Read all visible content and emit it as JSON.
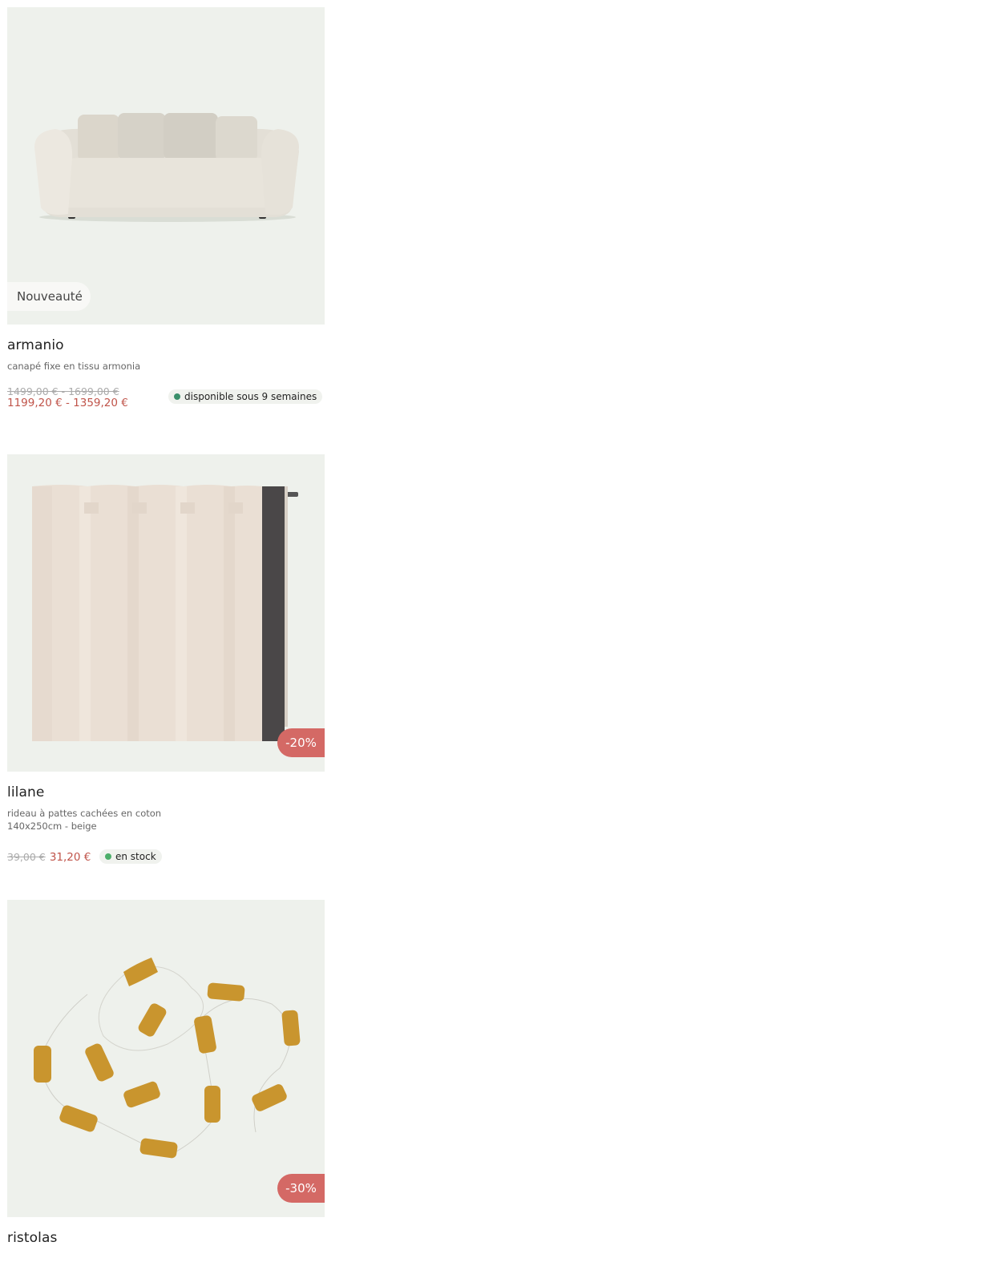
{
  "products": [
    {
      "name": "armanio",
      "description": "canapé fixe en tissu armonia",
      "badge": "Nouveauté",
      "old_price": "1499,00 € - 1699,00 €",
      "new_price": "1199,20 € - 1359,20 €",
      "availability": "disponible sous 9 semaines",
      "availability_color": "#3a8f6a",
      "image_icon": "sofa-image"
    },
    {
      "name": "lilane",
      "description": "rideau à pattes cachées en coton 140x250cm - beige",
      "badge": "-20%",
      "old_price": "39,00 €",
      "new_price": "31,20 €",
      "availability": "en stock",
      "availability_color": "#4cae6a",
      "image_icon": "curtain-image"
    },
    {
      "name": "ristolas",
      "badge": "-30%",
      "image_icon": "garland-image"
    }
  ],
  "colors": {
    "card_bg": "#eef1ec",
    "sale_badge": "#d46965",
    "sale_price": "#c0544a"
  }
}
